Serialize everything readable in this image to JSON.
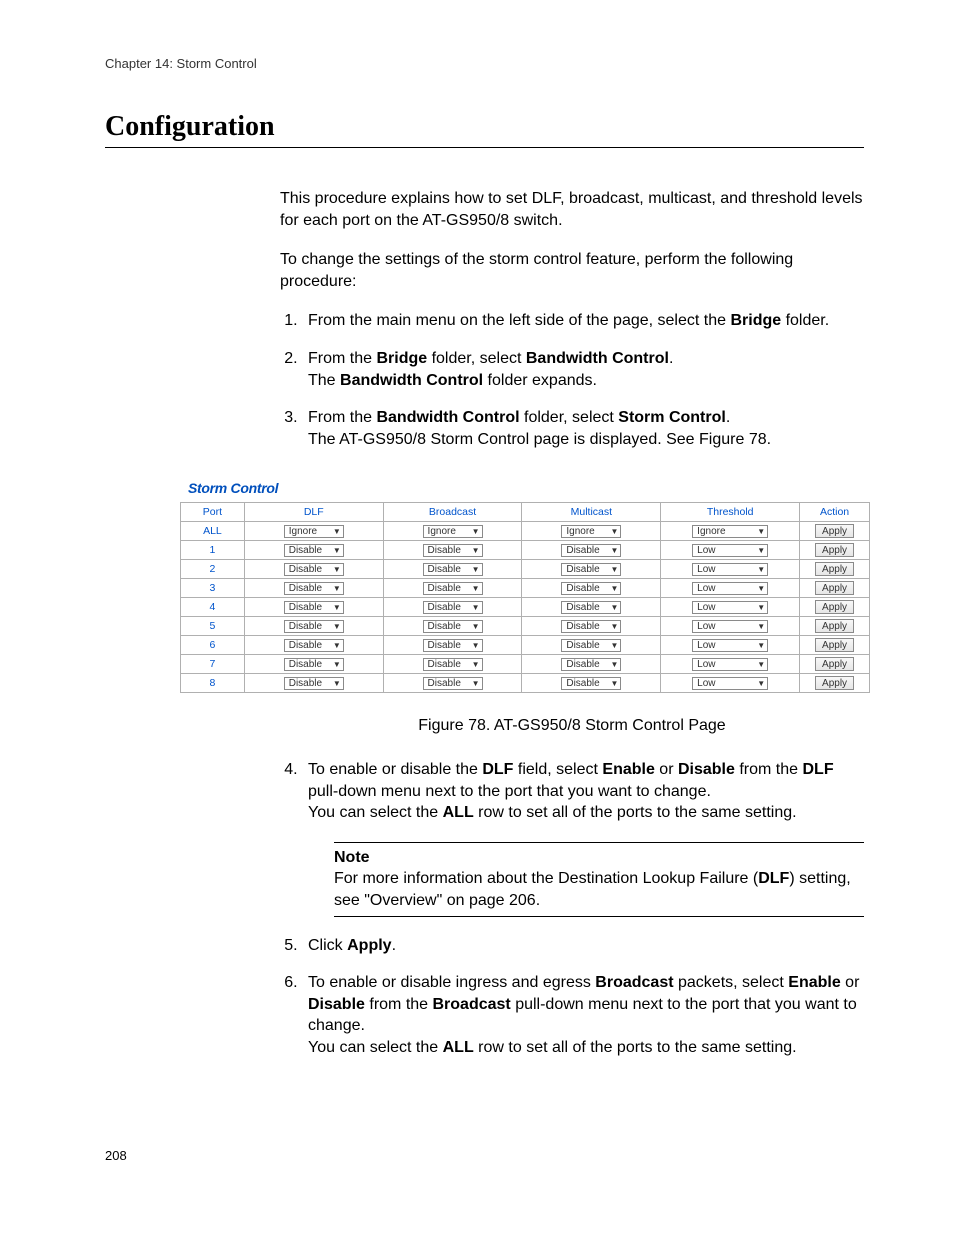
{
  "chapter": "Chapter 14: Storm Control",
  "section_title": "Configuration",
  "intro_p1": "This procedure explains how to set DLF, broadcast, multicast, and threshold levels for each port on the AT-GS950/8 switch.",
  "intro_p2": "To change the settings of the storm control feature, perform the following procedure:",
  "step1_a": "From the main menu on the left side of the page, select the ",
  "step1_bold": "Bridge",
  "step1_b": " folder.",
  "step2_a": "From the ",
  "step2_b1": "Bridge",
  "step2_c": " folder, select ",
  "step2_b2": "Bandwidth Control",
  "step2_d": ".",
  "step2_line2a": "The ",
  "step2_line2b": "Bandwidth Control",
  "step2_line2c": " folder expands.",
  "step3_a": "From the ",
  "step3_b1": "Bandwidth Control",
  "step3_b": " folder, select ",
  "step3_b2": "Storm Control",
  "step3_c": ".",
  "step3_line2": "The AT-GS950/8 Storm Control page is displayed. See Figure 78.",
  "figure_heading": "Storm Control",
  "figure_caption": "Figure 78. AT-GS950/8 Storm Control Page",
  "columns": {
    "port": "Port",
    "dlf": "DLF",
    "broadcast": "Broadcast",
    "multicast": "Multicast",
    "threshold": "Threshold",
    "action": "Action"
  },
  "rows": [
    {
      "port": "ALL",
      "dlf": "Ignore",
      "broadcast": "Ignore",
      "multicast": "Ignore",
      "threshold": "Ignore",
      "action": "Apply"
    },
    {
      "port": "1",
      "dlf": "Disable",
      "broadcast": "Disable",
      "multicast": "Disable",
      "threshold": "Low",
      "action": "Apply"
    },
    {
      "port": "2",
      "dlf": "Disable",
      "broadcast": "Disable",
      "multicast": "Disable",
      "threshold": "Low",
      "action": "Apply"
    },
    {
      "port": "3",
      "dlf": "Disable",
      "broadcast": "Disable",
      "multicast": "Disable",
      "threshold": "Low",
      "action": "Apply"
    },
    {
      "port": "4",
      "dlf": "Disable",
      "broadcast": "Disable",
      "multicast": "Disable",
      "threshold": "Low",
      "action": "Apply"
    },
    {
      "port": "5",
      "dlf": "Disable",
      "broadcast": "Disable",
      "multicast": "Disable",
      "threshold": "Low",
      "action": "Apply"
    },
    {
      "port": "6",
      "dlf": "Disable",
      "broadcast": "Disable",
      "multicast": "Disable",
      "threshold": "Low",
      "action": "Apply"
    },
    {
      "port": "7",
      "dlf": "Disable",
      "broadcast": "Disable",
      "multicast": "Disable",
      "threshold": "Low",
      "action": "Apply"
    },
    {
      "port": "8",
      "dlf": "Disable",
      "broadcast": "Disable",
      "multicast": "Disable",
      "threshold": "Low",
      "action": "Apply"
    }
  ],
  "step4_a": "To enable or disable the ",
  "step4_b1": "DLF",
  "step4_b": " field, select ",
  "step4_b2": "Enable",
  "step4_c": " or ",
  "step4_b3": "Disable",
  "step4_d": " from the ",
  "step4_b4": "DLF",
  "step4_e": " pull-down menu next to the port that you want to change.",
  "step4_line2a": "You can select the ",
  "step4_line2b": "ALL",
  "step4_line2c": " row to set all of the ports to the same setting.",
  "note_label": "Note",
  "note_a": "For more information about the Destination Lookup Failure (",
  "note_b": "DLF",
  "note_c": ") setting, see \"Overview\" on page 206.",
  "step5_a": "Click ",
  "step5_b": "Apply",
  "step5_c": ".",
  "step6_a": "To enable or disable ingress and egress ",
  "step6_b1": "Broadcast",
  "step6_b": " packets, select ",
  "step6_b2": "Enable",
  "step6_c": " or ",
  "step6_b3": "Disable",
  "step6_d": " from the ",
  "step6_b4": "Broadcast",
  "step6_e": " pull-down menu next to the port that you want to change.",
  "step6_line2a": "You can select the ",
  "step6_line2b": "ALL",
  "step6_line2c": " row to set all of the ports to the same setting.",
  "page_number": "208"
}
